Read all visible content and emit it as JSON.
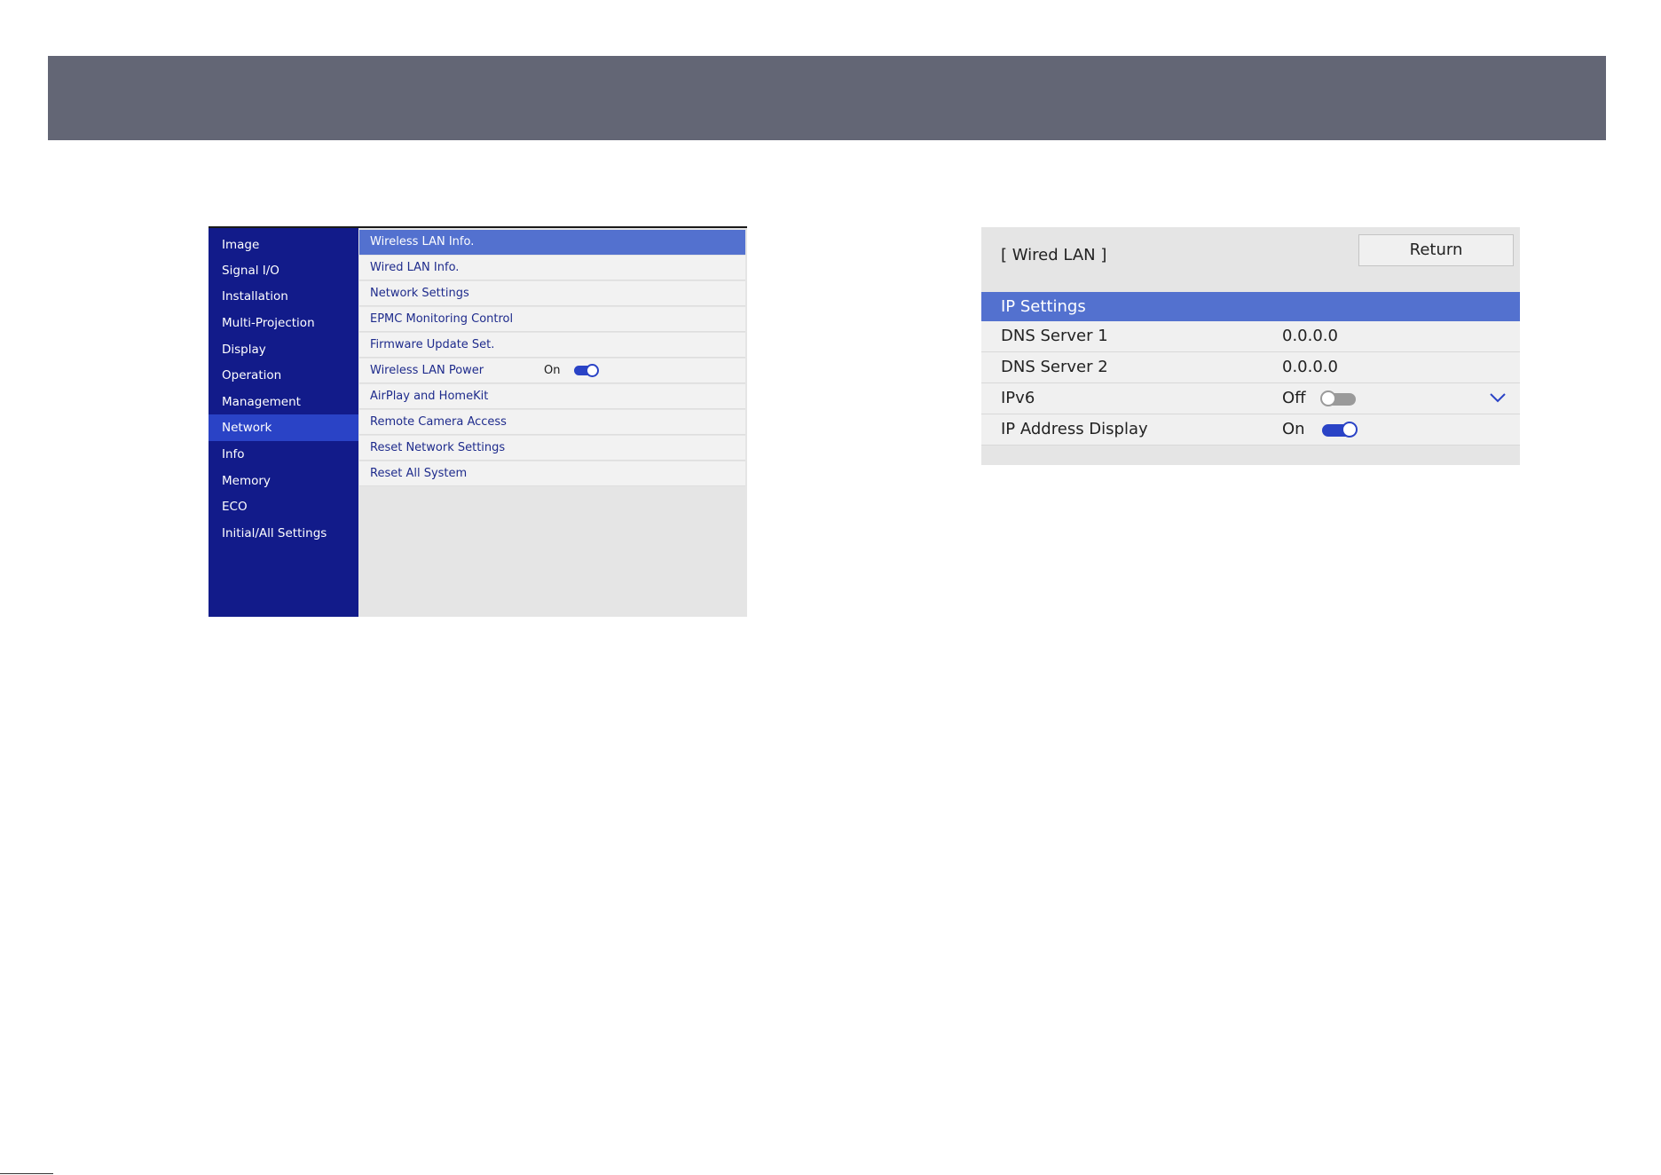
{
  "menu": {
    "sidebar": [
      {
        "label": "Image"
      },
      {
        "label": "Signal I/O"
      },
      {
        "label": "Installation"
      },
      {
        "label": "Multi-Projection"
      },
      {
        "label": "Display"
      },
      {
        "label": "Operation"
      },
      {
        "label": "Management"
      },
      {
        "label": "Network",
        "selected": true
      },
      {
        "label": "Info"
      },
      {
        "label": "Memory"
      },
      {
        "label": "ECO"
      },
      {
        "label": "Initial/All Settings"
      }
    ],
    "network_items": [
      {
        "label": "Wireless LAN Info.",
        "highlighted": true
      },
      {
        "label": "Wired LAN Info."
      },
      {
        "label": "Network Settings"
      },
      {
        "label": "EPMC Monitoring Control"
      },
      {
        "label": "Firmware Update Set."
      },
      {
        "label": "Wireless LAN Power",
        "value": "On",
        "toggle": "on"
      },
      {
        "label": "AirPlay and HomeKit"
      },
      {
        "label": "Remote Camera Access"
      },
      {
        "label": "Reset Network Settings"
      },
      {
        "label": "Reset All System"
      }
    ]
  },
  "wired_lan": {
    "title": "[ Wired LAN ]",
    "return_label": "Return",
    "section": "IP Settings",
    "rows": [
      {
        "label": "DNS Server 1",
        "value": "0.0.0.0"
      },
      {
        "label": "DNS Server 2",
        "value": "0.0.0.0"
      },
      {
        "label": "IPv6",
        "value": "Off",
        "toggle": "off"
      },
      {
        "label": "IP Address Display",
        "value": "On",
        "toggle": "on"
      }
    ]
  },
  "colors": {
    "header_band": "#636675",
    "sidebar_bg": "#121b8a",
    "sidebar_selected": "#2a43c6",
    "highlight": "#5371cf",
    "panel_bg": "#e5e5e5"
  }
}
